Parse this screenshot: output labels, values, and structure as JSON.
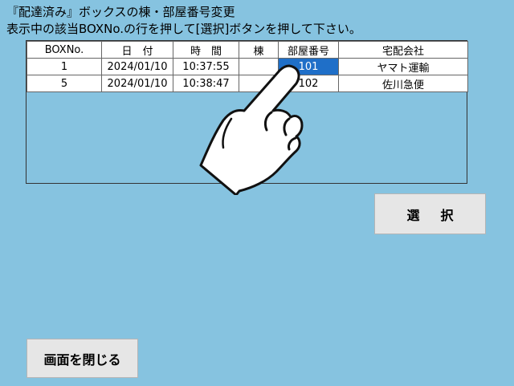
{
  "instructions": {
    "line1": "『配達済み』ボックスの棟・部屋番号変更",
    "line2": "表示中の該当BOXNo.の行を押して[選択]ボタンを押して下さい。"
  },
  "table": {
    "headers": [
      "BOXNo.",
      "日　付",
      "時　間",
      "棟",
      "部屋番号",
      "宅配会社"
    ],
    "rows": [
      [
        "1",
        "2024/01/10",
        "10:37:55",
        "",
        "101",
        "ヤマト運輸"
      ],
      [
        "5",
        "2024/01/10",
        "10:38:47",
        "",
        "102",
        "佐川急便"
      ]
    ]
  },
  "buttons": {
    "select": "選択",
    "close": "画面を閉じる"
  },
  "colors": {
    "background": "#86c3e0",
    "selected_cell": "#1f6fc8"
  },
  "icons": {
    "pointer": "pointing-hand-icon"
  }
}
